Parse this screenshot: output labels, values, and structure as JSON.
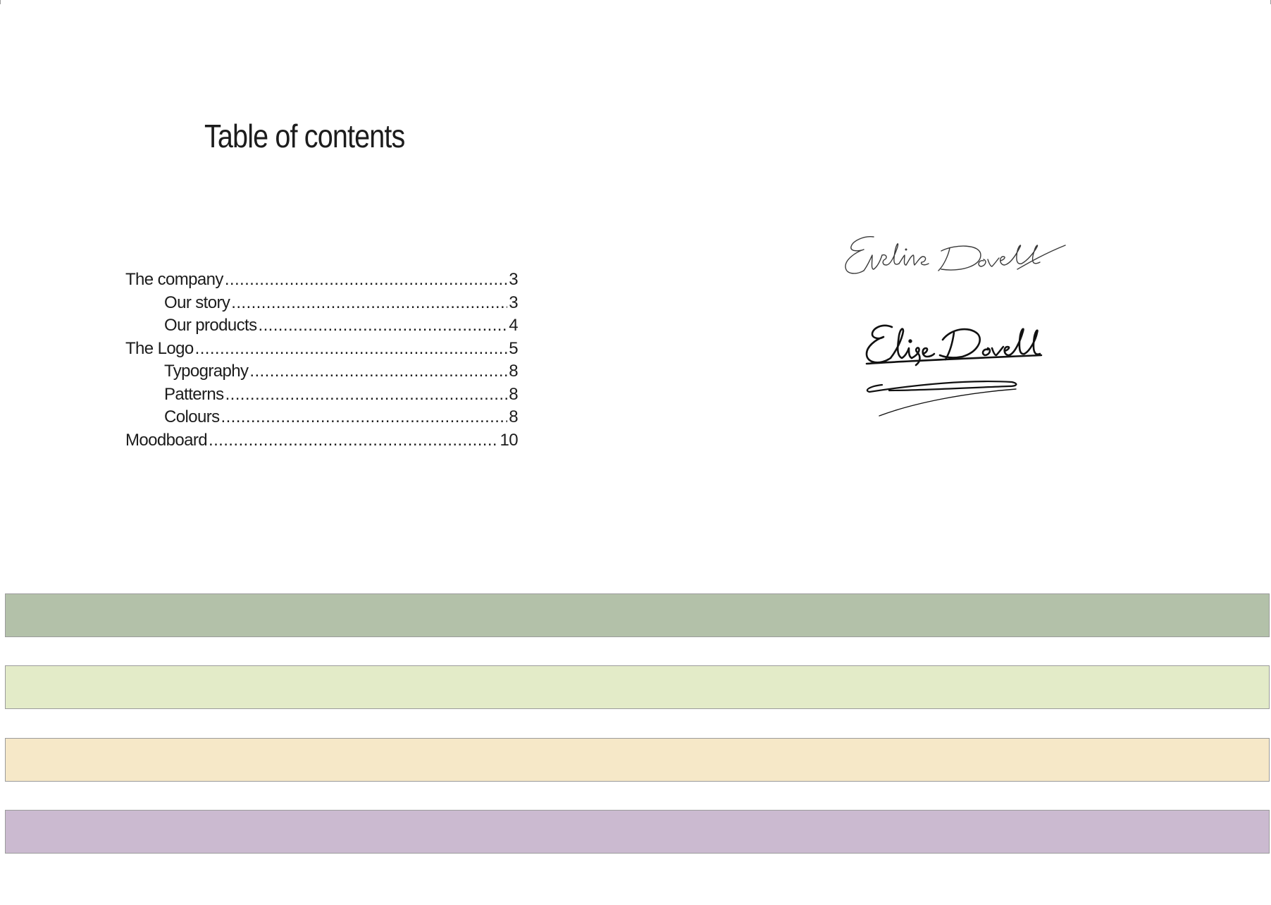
{
  "document": {
    "title": "Table of contents"
  },
  "toc": {
    "entries": [
      {
        "label": "The company",
        "page": "3",
        "level": 1
      },
      {
        "label": "Our story",
        "page": "3",
        "level": 2
      },
      {
        "label": "Our products",
        "page": "4",
        "level": 2
      },
      {
        "label": "The Logo",
        "page": "5",
        "level": 1
      },
      {
        "label": "Typography",
        "page": "8",
        "level": 2
      },
      {
        "label": "Patterns",
        "page": "8",
        "level": 2
      },
      {
        "label": "Colours",
        "page": "8",
        "level": 2
      },
      {
        "label": "Moodboard",
        "page": "10",
        "level": 1
      }
    ]
  },
  "signatures": [
    {
      "text": "Eveline Dovell",
      "style": "thin-pen",
      "color": "#3a3a3a"
    },
    {
      "text": "Elise Dovell",
      "style": "bold-pen-underlined",
      "color": "#111111"
    }
  ],
  "colour_palette": [
    {
      "name": "sage-green",
      "color": "#b3c1a9"
    },
    {
      "name": "pale-lime",
      "color": "#e3ebc8"
    },
    {
      "name": "cream",
      "color": "#f6e8c8"
    },
    {
      "name": "lavender",
      "color": "#cbbad0"
    }
  ]
}
